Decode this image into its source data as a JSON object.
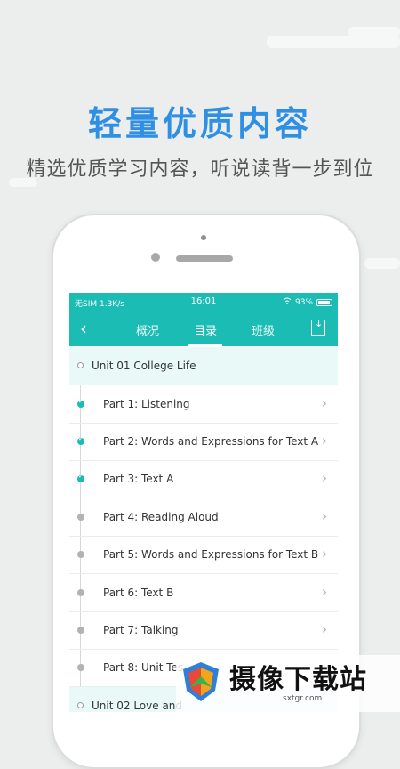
{
  "promo": {
    "headline": "轻量优质内容",
    "subline": "精选优质学习内容，听说读背一步到位"
  },
  "status_bar": {
    "carrier": "无SIM 1.3K/s",
    "time": "16:01",
    "battery": "93%"
  },
  "nav": {
    "tabs": [
      {
        "label": "概况",
        "active": false
      },
      {
        "label": "目录",
        "active": true
      },
      {
        "label": "班级",
        "active": false
      }
    ]
  },
  "units": [
    {
      "title": "Unit 01 College Life"
    },
    {
      "title": "Unit 02 Love and"
    }
  ],
  "parts": [
    {
      "label": "Part 1: Listening",
      "status": "done"
    },
    {
      "label": "Part 2: Words and Expressions for Text A",
      "status": "done"
    },
    {
      "label": "Part 3: Text A",
      "status": "done"
    },
    {
      "label": "Part 4: Reading Aloud",
      "status": "todo"
    },
    {
      "label": "Part 5: Words and Expressions for Text B",
      "status": "todo"
    },
    {
      "label": "Part 6: Text B",
      "status": "todo"
    },
    {
      "label": "Part 7: Talking",
      "status": "todo"
    },
    {
      "label": "Part 8: Unit Tes",
      "status": "todo"
    }
  ],
  "watermark": {
    "name": "摄像下载站",
    "url": "sxtgr.com"
  },
  "colors": {
    "accent": "#1bbcb3",
    "headline": "#2f8fe3",
    "unit_row_bg": "#e8f9f8"
  }
}
